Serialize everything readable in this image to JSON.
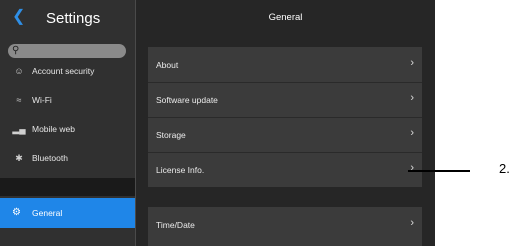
{
  "sidebar": {
    "title": "Settings",
    "items": [
      {
        "label": "Account security",
        "icon": "person-icon"
      },
      {
        "label": "Wi-Fi",
        "icon": "wifi-icon"
      },
      {
        "label": "Mobile web",
        "icon": "signal-icon"
      },
      {
        "label": "Bluetooth",
        "icon": "bluetooth-icon"
      }
    ],
    "selected": {
      "label": "General",
      "icon": "gear-icon"
    }
  },
  "main": {
    "title": "General",
    "group1": [
      "About",
      "Software update",
      "Storage",
      "License Info."
    ],
    "group2": [
      "Time/Date"
    ]
  },
  "callout": {
    "label": "2."
  },
  "colors": {
    "accent": "#1f86e8",
    "background": "#262626",
    "row": "#3b3b3b"
  }
}
